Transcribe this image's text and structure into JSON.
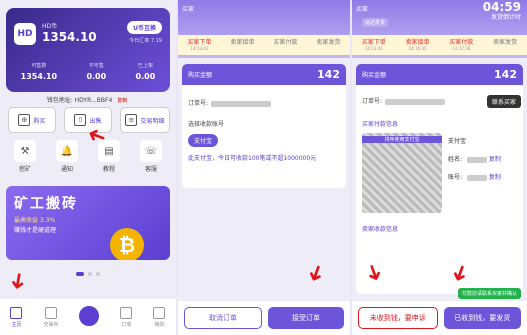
{
  "panel1": {
    "hd_label": "HD币",
    "hd_balance": "1354.10",
    "swap_label": "U币互换",
    "rate": "今日汇率 7.19",
    "stats": [
      {
        "label": "可售数",
        "value": "1354.10"
      },
      {
        "label": "不可售",
        "value": "0.00"
      },
      {
        "label": "已上架",
        "value": "0.00"
      }
    ],
    "wallet_label": "钱包地址: HDYR...BBF4",
    "copy": "复制",
    "actions": [
      "购买",
      "出售",
      "交易明细"
    ],
    "quick": [
      "挖矿",
      "通知",
      "教程",
      "客服"
    ],
    "banner": {
      "title": "矿工搬砖",
      "sub1": "最高收益 3.3%",
      "sub2": "赚钱才是硬道理"
    },
    "tabs": [
      "主页",
      "交易中",
      "",
      "订单",
      "我的"
    ]
  },
  "panel2": {
    "top_left": "买家",
    "steps": [
      {
        "label": "买家下单",
        "time": "14:13:41"
      },
      {
        "label": "卖家接单",
        "time": ""
      },
      {
        "label": "买家付款",
        "time": ""
      },
      {
        "label": "卖家发货",
        "time": ""
      }
    ],
    "amount_label": "购买金额",
    "amount": "142",
    "order_label": "订单号:",
    "choose_label": "选择收款账号",
    "pay_method": "支付宝",
    "note": "此支付宝，今日可收款100笔或不超1000000元",
    "cancel": "取消订单",
    "accept": "接受订单"
  },
  "panel3": {
    "top_left": "买家",
    "top_time": "04:59",
    "top_sub": "发货倒计时",
    "top_tag": "延迟发货",
    "steps": [
      {
        "label": "买家下单",
        "time": "14:13:41"
      },
      {
        "label": "卖家接单",
        "time": "14:16:45"
      },
      {
        "label": "买家付款",
        "time": "14:17:28"
      },
      {
        "label": "卖家发货",
        "time": ""
      }
    ],
    "amount_label": "购买金额",
    "amount": "142",
    "order_label": "订单号:",
    "contact": "联系买家",
    "buyer_info": "买家付款信息",
    "qr_caption": "排序使用支付宝",
    "pay_method": "支付宝",
    "name_label": "姓名:",
    "account_label": "账号:",
    "copy": "复制",
    "seller_info": "卖家收款信息",
    "tip": "付款前请联系买家并确认",
    "not_received": "未收到钱，要申诉",
    "received": "已收到钱，要发货"
  }
}
